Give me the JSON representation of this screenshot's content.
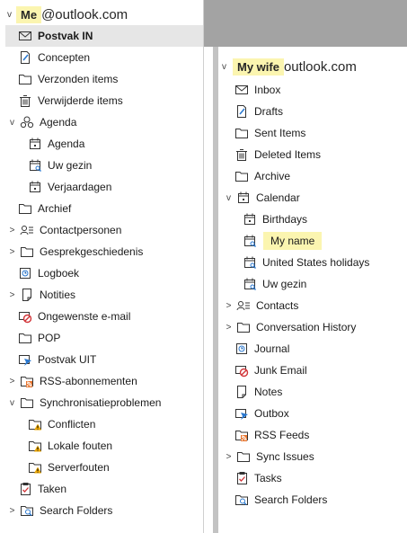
{
  "left": {
    "account_prefix": "v",
    "account_tag": "Me",
    "account_domain": "@outlook.com",
    "items": [
      {
        "label": "Postvak IN",
        "icon": "inbox-icon",
        "indent": 1,
        "selected": true,
        "bold": true
      },
      {
        "label": "Concepten",
        "icon": "drafts-icon",
        "indent": 1
      },
      {
        "label": "Verzonden items",
        "icon": "folder-icon",
        "indent": 1
      },
      {
        "label": "Verwijderde items",
        "icon": "trash-icon",
        "indent": 1
      },
      {
        "label": "Agenda",
        "icon": "calendar-group-icon",
        "indent": 0,
        "chevron": "down"
      },
      {
        "label": "Agenda",
        "icon": "calendar-icon",
        "indent": 2
      },
      {
        "label": "Uw gezin",
        "icon": "shared-calendar-icon",
        "indent": 2
      },
      {
        "label": "Verjaardagen",
        "icon": "calendar-icon",
        "indent": 2
      },
      {
        "label": "Archief",
        "icon": "folder-icon",
        "indent": 1
      },
      {
        "label": "Contactpersonen",
        "icon": "contacts-icon",
        "indent": 0,
        "chevron": "right"
      },
      {
        "label": "Gesprekgeschiedenis",
        "icon": "folder-icon",
        "indent": 0,
        "chevron": "right"
      },
      {
        "label": "Logboek",
        "icon": "journal-icon",
        "indent": 1
      },
      {
        "label": "Notities",
        "icon": "notes-icon",
        "indent": 0,
        "chevron": "right"
      },
      {
        "label": "Ongewenste e-mail",
        "icon": "junk-icon",
        "indent": 1
      },
      {
        "label": "POP",
        "icon": "folder-icon",
        "indent": 1
      },
      {
        "label": "Postvak UIT",
        "icon": "outbox-icon",
        "indent": 1
      },
      {
        "label": "RSS-abonnementen",
        "icon": "rss-icon",
        "indent": 0,
        "chevron": "right"
      },
      {
        "label": "Synchronisatieproblemen",
        "icon": "folder-icon",
        "indent": 0,
        "chevron": "down"
      },
      {
        "label": "Conflicten",
        "icon": "sync-warning-icon",
        "indent": 2
      },
      {
        "label": "Lokale fouten",
        "icon": "sync-warning-icon",
        "indent": 2
      },
      {
        "label": "Serverfouten",
        "icon": "sync-warning-icon",
        "indent": 2
      },
      {
        "label": "Taken",
        "icon": "tasks-icon",
        "indent": 1
      },
      {
        "label": "Search Folders",
        "icon": "search-folder-icon",
        "indent": 0,
        "chevron": "right"
      }
    ]
  },
  "right": {
    "account_tag": "My wife",
    "account_domain": "outlook.com",
    "items": [
      {
        "label": "Inbox",
        "icon": "inbox-icon",
        "indent": 1
      },
      {
        "label": "Drafts",
        "icon": "drafts-icon",
        "indent": 1
      },
      {
        "label": "Sent Items",
        "icon": "folder-icon",
        "indent": 1
      },
      {
        "label": "Deleted Items",
        "icon": "trash-icon",
        "indent": 1
      },
      {
        "label": "Archive",
        "icon": "folder-icon",
        "indent": 1
      },
      {
        "label": "Calendar",
        "icon": "calendar-icon",
        "indent": 0,
        "chevron": "down"
      },
      {
        "label": "Birthdays",
        "icon": "calendar-icon",
        "indent": 2
      },
      {
        "label": "My name",
        "icon": "shared-calendar-icon",
        "indent": 2,
        "highlight": true
      },
      {
        "label": "United States holidays",
        "icon": "shared-calendar-icon",
        "indent": 2
      },
      {
        "label": "Uw gezin",
        "icon": "shared-calendar-icon",
        "indent": 2
      },
      {
        "label": "Contacts",
        "icon": "contacts-icon",
        "indent": 0,
        "chevron": "right"
      },
      {
        "label": "Conversation History",
        "icon": "folder-icon",
        "indent": 0,
        "chevron": "right"
      },
      {
        "label": "Journal",
        "icon": "journal-icon",
        "indent": 1
      },
      {
        "label": "Junk Email",
        "icon": "junk-icon",
        "indent": 1
      },
      {
        "label": "Notes",
        "icon": "notes-icon",
        "indent": 1
      },
      {
        "label": "Outbox",
        "icon": "outbox-icon",
        "indent": 1
      },
      {
        "label": "RSS Feeds",
        "icon": "rss-icon",
        "indent": 1
      },
      {
        "label": "Sync Issues",
        "icon": "folder-icon",
        "indent": 0,
        "chevron": "right"
      },
      {
        "label": "Tasks",
        "icon": "tasks-icon",
        "indent": 1
      },
      {
        "label": "Search Folders",
        "icon": "search-folder-icon",
        "indent": 1
      }
    ]
  },
  "colors": {
    "highlight": "#fbf5b0",
    "selected": "#e6e6e6",
    "accent": "#2b79d0",
    "junk": "#d13438",
    "rss": "#e8742d",
    "warning": "#e8a400"
  }
}
